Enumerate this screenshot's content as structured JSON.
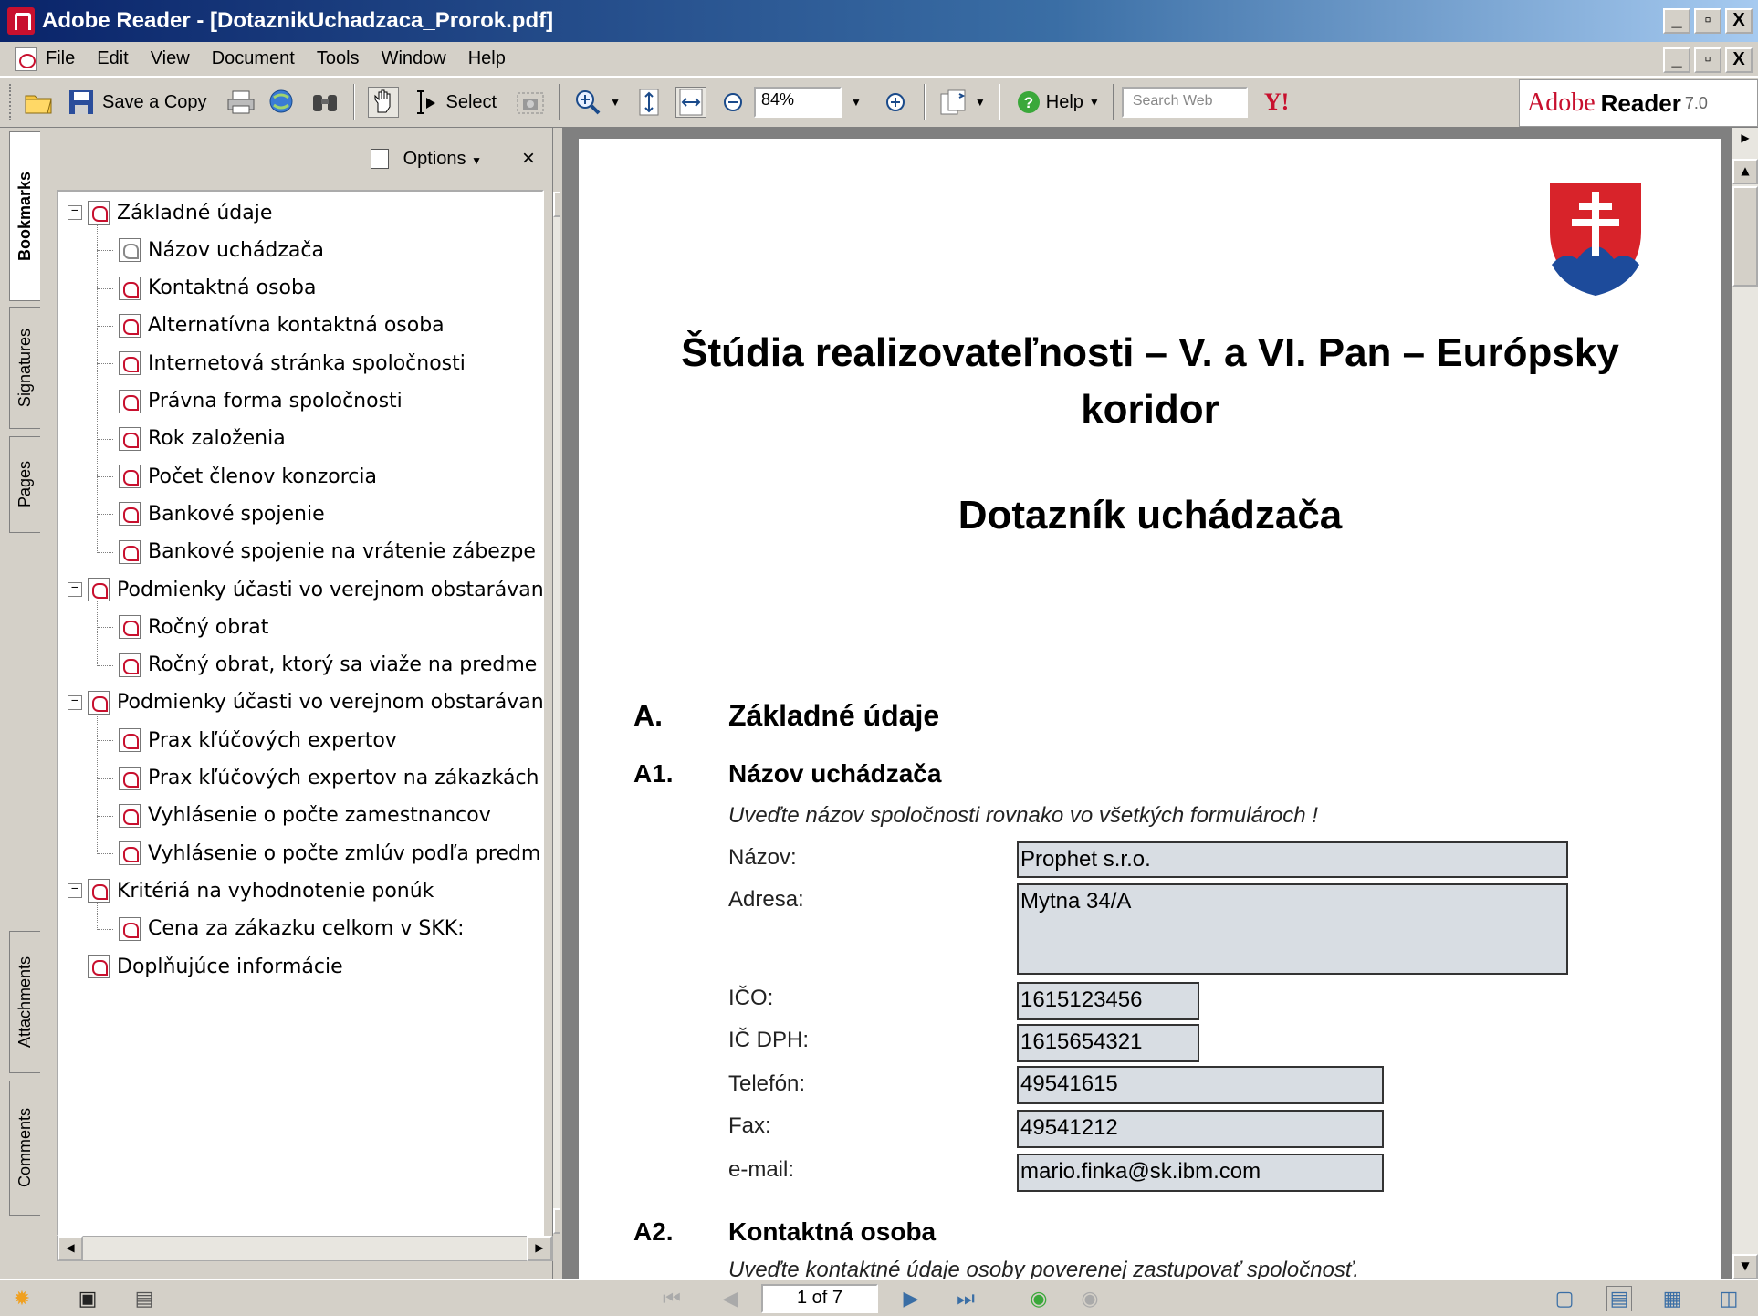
{
  "window": {
    "title": "Adobe Reader - [DotaznikUchadzaca_Prorok.pdf]",
    "min": "_",
    "max": "▫",
    "close": "X"
  },
  "menu": [
    "File",
    "Edit",
    "View",
    "Document",
    "Tools",
    "Window",
    "Help"
  ],
  "toolbar": {
    "save_copy": "Save a Copy",
    "select": "Select",
    "zoom": "84%",
    "help": "Help",
    "search_placeholder": "Search Web",
    "yahoo": "Y!",
    "brand_adobe": "Adobe",
    "brand_reader": "Reader",
    "brand_version": "7.0"
  },
  "navtabs": [
    "Bookmarks",
    "Signatures",
    "Pages",
    "Attachments",
    "Comments"
  ],
  "bookmarks": {
    "options": "Options",
    "close": "×",
    "items": [
      {
        "label": "Základné údaje",
        "level": 0
      },
      {
        "label": "Názov uchádzača",
        "level": 1
      },
      {
        "label": "Kontaktná osoba",
        "level": 1
      },
      {
        "label": "Alternatívna kontaktná osoba",
        "level": 1
      },
      {
        "label": "Internetová stránka spoločnosti",
        "level": 1
      },
      {
        "label": "Právna forma spoločnosti",
        "level": 1
      },
      {
        "label": "Rok založenia",
        "level": 1
      },
      {
        "label": "Počet členov konzorcia",
        "level": 1
      },
      {
        "label": "Bankové spojenie",
        "level": 1
      },
      {
        "label": "Bankové spojenie na vrátenie zábezpe",
        "level": 1
      },
      {
        "label": "Podmienky účasti vo verejnom obstarávan",
        "level": 0
      },
      {
        "label": "Ročný obrat",
        "level": 1
      },
      {
        "label": "Ročný obrat, ktorý sa viaže na predme",
        "level": 1
      },
      {
        "label": "Podmienky účasti vo verejnom obstarávan",
        "level": 0
      },
      {
        "label": "Prax kľúčových expertov",
        "level": 1
      },
      {
        "label": "Prax kľúčových expertov na zákazkách",
        "level": 1
      },
      {
        "label": "Vyhlásenie o počte zamestnancov",
        "level": 1
      },
      {
        "label": "Vyhlásenie o počte zmlúv podľa predm",
        "level": 1
      },
      {
        "label": "Kritériá na vyhodnotenie ponúk",
        "level": 0
      },
      {
        "label": "Cena za zákazku celkom v SKK:",
        "level": 1
      },
      {
        "label": "Doplňujúce informácie",
        "level": 0
      }
    ]
  },
  "document": {
    "title_line1": "Štúdia realizovateľnosti – V. a VI. Pan – Európsky",
    "title_line2": "koridor",
    "subtitle": "Dotazník uchádzača",
    "section_a_num": "A.",
    "section_a_title": "Základné údaje",
    "a1_num": "A1.",
    "a1_title": "Názov uchádzača",
    "a1_note": "Uveďte názov spoločnosti rovnako vo všetkých formulároch !",
    "fields": [
      {
        "label": "Názov:",
        "value": "Prophet s.r.o."
      },
      {
        "label": "Adresa:",
        "value": "Mytna 34/A"
      },
      {
        "label": "IČO:",
        "value": "1615123456"
      },
      {
        "label": "IČ DPH:",
        "value": "1615654321"
      },
      {
        "label": "Telefón:",
        "value": "49541615"
      },
      {
        "label": "Fax:",
        "value": "49541212"
      },
      {
        "label": "e-mail:",
        "value": "mario.finka@sk.ibm.com"
      }
    ],
    "a2_num": "A2.",
    "a2_title": "Kontaktná osoba",
    "a2_note": "Uveďte kontaktné údaje osoby poverenej zastupovať spoločnosť."
  },
  "status": {
    "page": "1 of 7"
  }
}
